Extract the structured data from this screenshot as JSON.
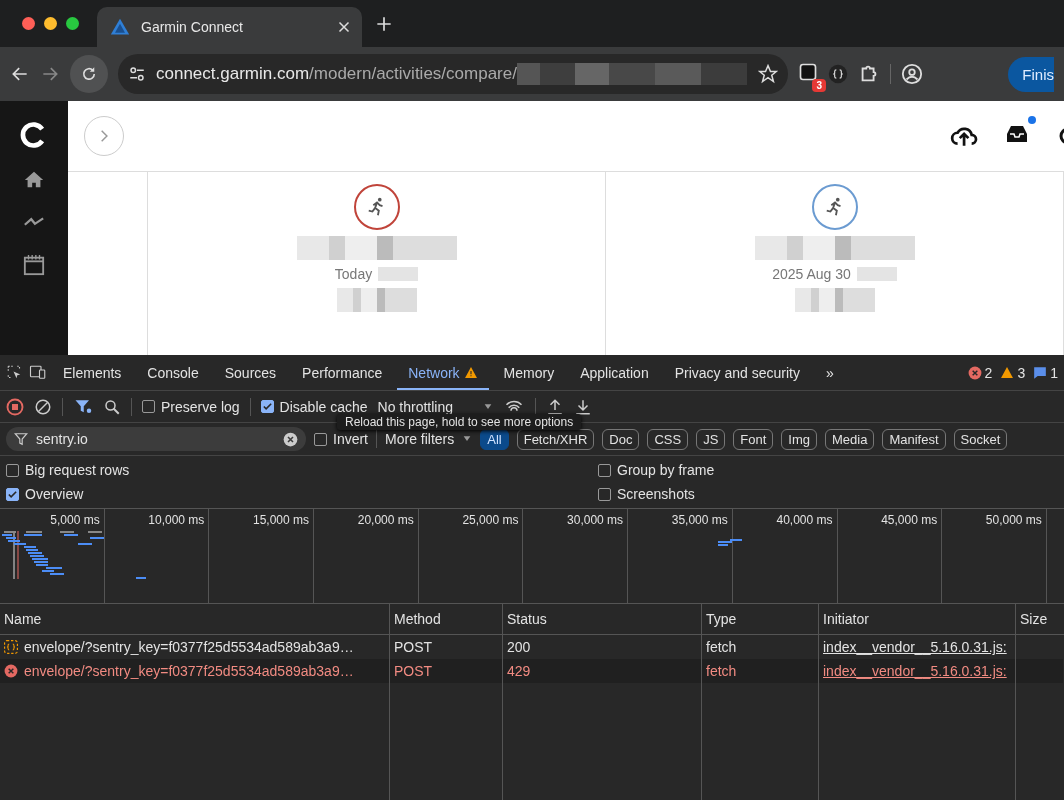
{
  "browser": {
    "tab_title": "Garmin Connect",
    "url_host": "connect.garmin.com",
    "url_path": "/modern/activities/compare/",
    "extension_badge": "3",
    "profile_button": "Finis"
  },
  "page": {
    "activities": [
      {
        "date": "Today",
        "color": "#c0443a"
      },
      {
        "date": "2025 Aug 30",
        "color": "#6b9bd1"
      }
    ]
  },
  "devtools": {
    "tabs": [
      {
        "label": "Elements",
        "selected": false,
        "warning": false
      },
      {
        "label": "Console",
        "selected": false,
        "warning": false
      },
      {
        "label": "Sources",
        "selected": false,
        "warning": false
      },
      {
        "label": "Performance",
        "selected": false,
        "warning": false
      },
      {
        "label": "Network",
        "selected": true,
        "warning": true
      },
      {
        "label": "Memory",
        "selected": false,
        "warning": false
      },
      {
        "label": "Application",
        "selected": false,
        "warning": false
      },
      {
        "label": "Privacy and security",
        "selected": false,
        "warning": false
      }
    ],
    "more_tabs": "»",
    "errors": "2",
    "warnings": "3",
    "messages": "1",
    "toolbar": {
      "recording": true,
      "preserve_log": {
        "label": "Preserve log",
        "checked": false
      },
      "disable_cache": {
        "label": "Disable cache",
        "checked": true
      },
      "throttling": "No throttling",
      "tooltip": "Reload this page, hold to see more options"
    },
    "filter": {
      "value": "sentry.io",
      "invert": {
        "label": "Invert",
        "checked": false
      },
      "more_filters": "More filters",
      "types": [
        {
          "label": "All",
          "selected": true
        },
        {
          "label": "Fetch/XHR",
          "selected": false
        },
        {
          "label": "Doc",
          "selected": false
        },
        {
          "label": "CSS",
          "selected": false
        },
        {
          "label": "JS",
          "selected": false
        },
        {
          "label": "Font",
          "selected": false
        },
        {
          "label": "Img",
          "selected": false
        },
        {
          "label": "Media",
          "selected": false
        },
        {
          "label": "Manifest",
          "selected": false
        },
        {
          "label": "Socket",
          "selected": false
        }
      ]
    },
    "settings": [
      {
        "label": "Big request rows",
        "checked": false
      },
      {
        "label": "Group by frame",
        "checked": false
      },
      {
        "label": "Overview",
        "checked": true
      },
      {
        "label": "Screenshots",
        "checked": false
      }
    ],
    "timeline_ticks": [
      "5,000 ms",
      "10,000 ms",
      "15,000 ms",
      "20,000 ms",
      "25,000 ms",
      "30,000 ms",
      "35,000 ms",
      "40,000 ms",
      "45,000 ms",
      "50,000 ms"
    ],
    "table": {
      "columns": [
        "Name",
        "Method",
        "Status",
        "Type",
        "Initiator",
        "Size"
      ],
      "rows": [
        {
          "name": "envelope/?sentry_key=f0377f25d5534ad589ab3a9…",
          "method": "POST",
          "status": "200",
          "type": "fetch",
          "initiator": "index__vendor__5.16.0.31.js:",
          "failed": false
        },
        {
          "name": "envelope/?sentry_key=f0377f25d5534ad589ab3a9…",
          "method": "POST",
          "status": "429",
          "type": "fetch",
          "initiator": "index__vendor__5.16.0.31.js:",
          "failed": true
        }
      ]
    }
  }
}
